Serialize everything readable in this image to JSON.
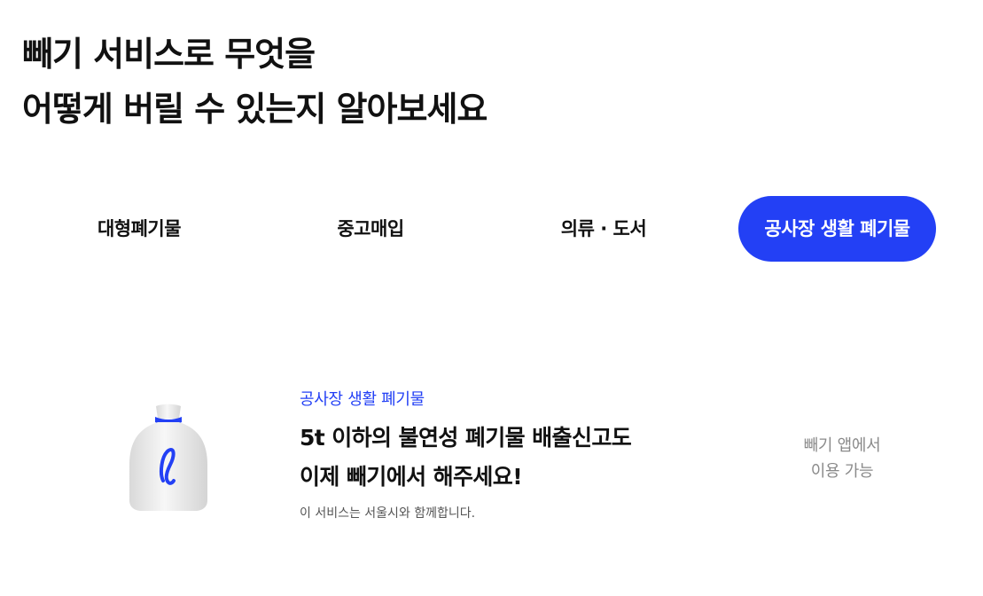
{
  "headline": {
    "line1": "빼기 서비스로 무엇을",
    "line2": "어떻게 버릴 수 있는지 알아보세요"
  },
  "tabs": [
    {
      "label": "대형폐기물",
      "active": false
    },
    {
      "label": "중고매입",
      "active": false
    },
    {
      "label": "의류 · 도서",
      "active": false
    },
    {
      "label": "공사장 생활 폐기물",
      "active": true
    }
  ],
  "colors": {
    "accent": "#2340f5",
    "bag_body": "#ececec",
    "bag_logo": "#2340f5"
  },
  "service": {
    "icon": "waste-bag-icon",
    "category": "공사장 생활 폐기물",
    "title_line1": "5t 이하의 불연성 폐기물 배출신고도",
    "title_line2": "이제 빼기에서 해주세요!",
    "note": "이 서비스는 서울시와 함께합니다.",
    "availability_line1": "빼기 앱에서",
    "availability_line2": "이용 가능"
  }
}
